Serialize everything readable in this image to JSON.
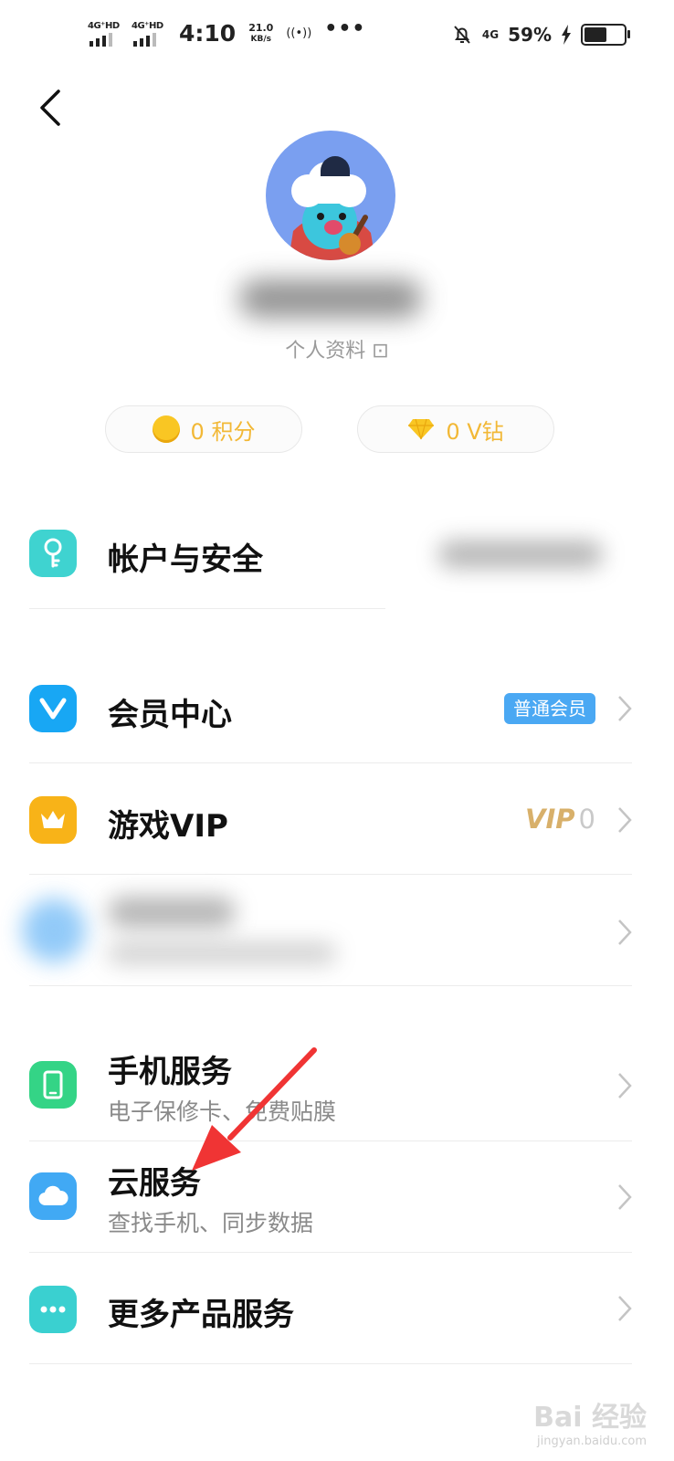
{
  "status_bar": {
    "sim1": "4G⁺HD",
    "sim2": "4G⁺HD",
    "time": "4:10",
    "speed_value": "21.0",
    "speed_unit": "KB/s",
    "hotspot": "((•))",
    "more": "•••",
    "network": "4G",
    "battery": "59%"
  },
  "profile": {
    "link_label": "个人资料 ⊡",
    "points_label": "0 积分",
    "vdiamond_label": "0 V钻"
  },
  "menu": {
    "account_security": "帐户与安全",
    "member_center": "会员中心",
    "member_badge": "普通会员",
    "game_vip": "游戏VIP",
    "game_vip_level_text": "VIP",
    "game_vip_level_value": "0",
    "phone_service": "手机服务",
    "phone_service_sub": "电子保修卡、免费贴膜",
    "cloud_service": "云服务",
    "cloud_service_sub": "查找手机、同步数据",
    "more_services": "更多产品服务"
  },
  "watermark": {
    "line1": "Bai 经验",
    "line2": "jingyan.baidu.com"
  },
  "colors": {
    "account_icon": "#3fd3d0",
    "member_icon": "#18a7f4",
    "vip_icon": "#f8b318",
    "phone_icon": "#34d486",
    "cloud_icon": "#41a9f4",
    "more_icon": "#3ad0d0",
    "arrow": "#f03434"
  }
}
